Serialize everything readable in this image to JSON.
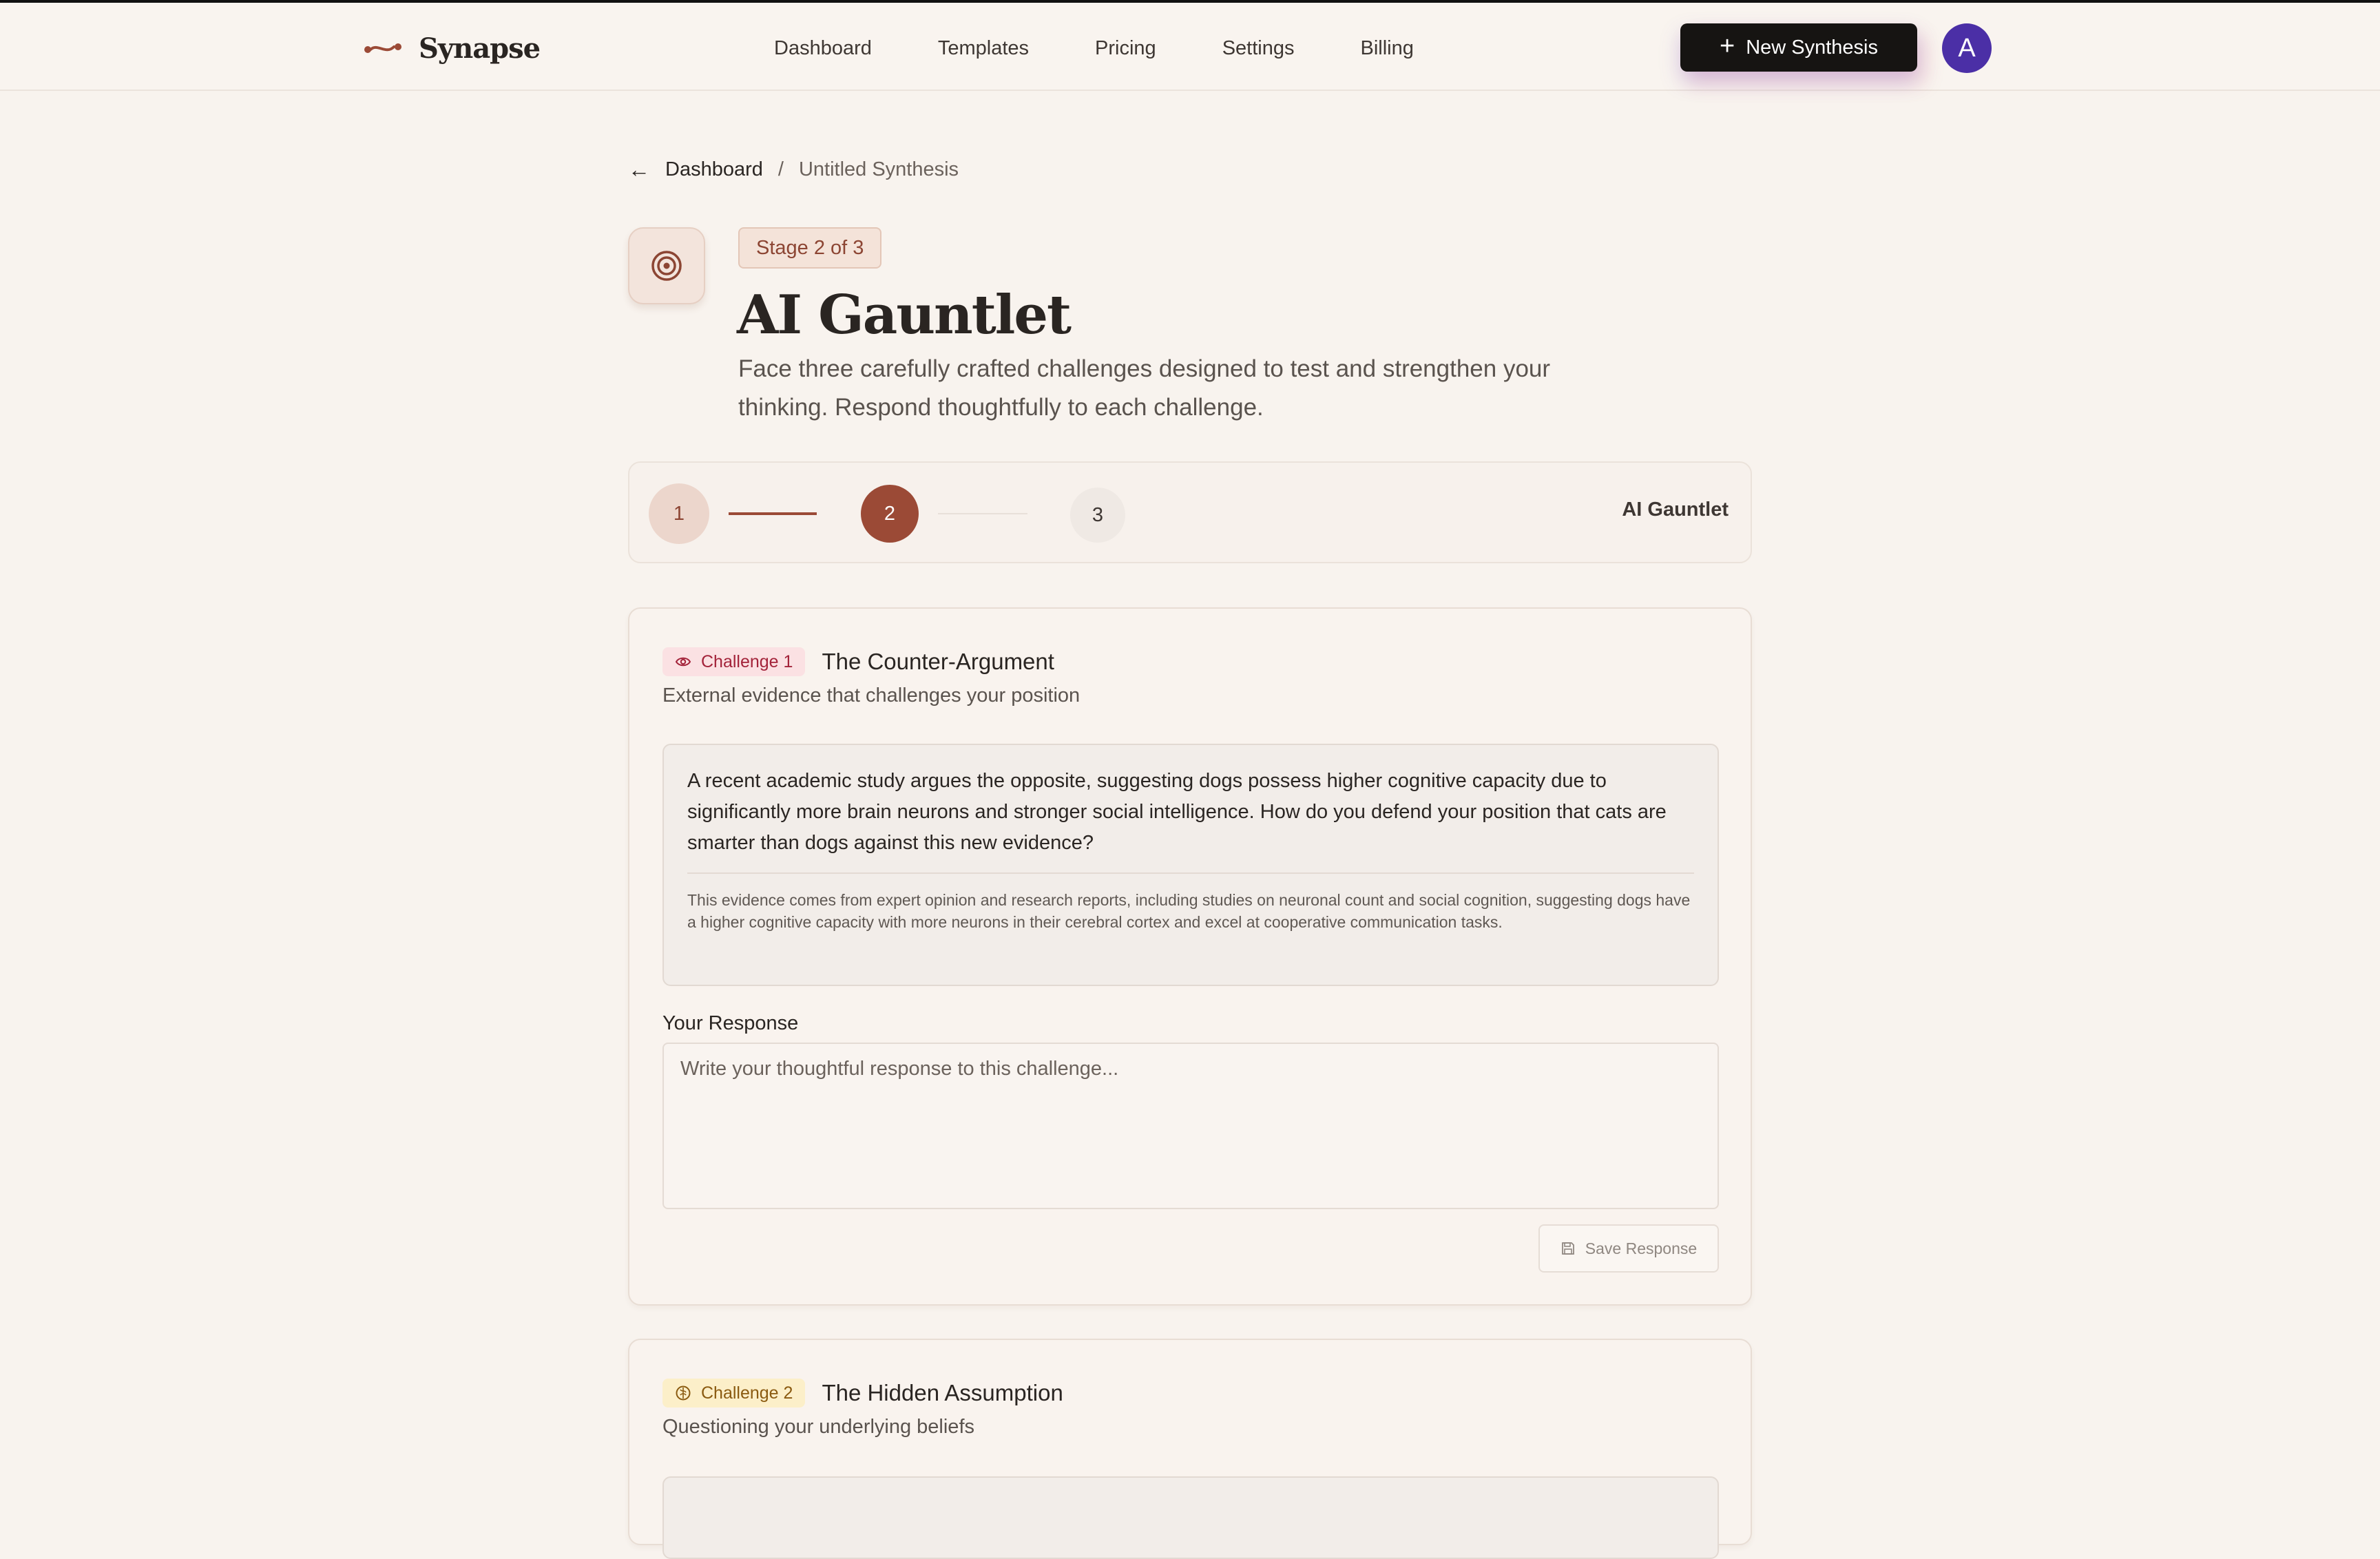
{
  "app": {
    "name": "Synapse",
    "colors": {
      "accent": "#9b4a36",
      "background": "#f8f3ee",
      "primary_button": "#161412",
      "avatar": "#4b2fa6"
    }
  },
  "nav": {
    "items": [
      {
        "label": "Dashboard"
      },
      {
        "label": "Templates"
      },
      {
        "label": "Pricing"
      },
      {
        "label": "Settings"
      },
      {
        "label": "Billing"
      }
    ],
    "new_button_label": "New Synthesis",
    "avatar_initial": "A"
  },
  "breadcrumb": {
    "home": "Dashboard",
    "separator": "/",
    "current": "Untitled Synthesis"
  },
  "header": {
    "stage_label": "Stage 2 of 3",
    "title": "AI Gauntlet",
    "description": "Face three carefully crafted challenges designed to test and strengthen your thinking. Respond thoughtfully to each challenge.",
    "icon": "target-icon"
  },
  "stepper": {
    "steps": [
      "1",
      "2",
      "3"
    ],
    "current_step": 2,
    "label": "AI Gauntlet"
  },
  "challenges": [
    {
      "chip": "Challenge 1",
      "chip_icon": "eye-icon",
      "title": "The Counter-Argument",
      "subtitle": "External evidence that challenges your position",
      "question": "A recent academic study argues the opposite, suggesting dogs possess higher cognitive capacity due to significantly more brain neurons and stronger social intelligence. How do you defend your position that cats are smarter than dogs against this new evidence?",
      "note": "This evidence comes from expert opinion and research reports, including studies on neuronal count and social cognition, suggesting dogs have a higher cognitive capacity with more neurons in their cerebral cortex and excel at cooperative communication tasks.",
      "response_label": "Your Response",
      "response_placeholder": "Write your thoughtful response to this challenge...",
      "response_value": "",
      "save_label": "Save Response"
    },
    {
      "chip": "Challenge 2",
      "chip_icon": "brain-icon",
      "title": "The Hidden Assumption",
      "subtitle": "Questioning your underlying beliefs"
    }
  ]
}
